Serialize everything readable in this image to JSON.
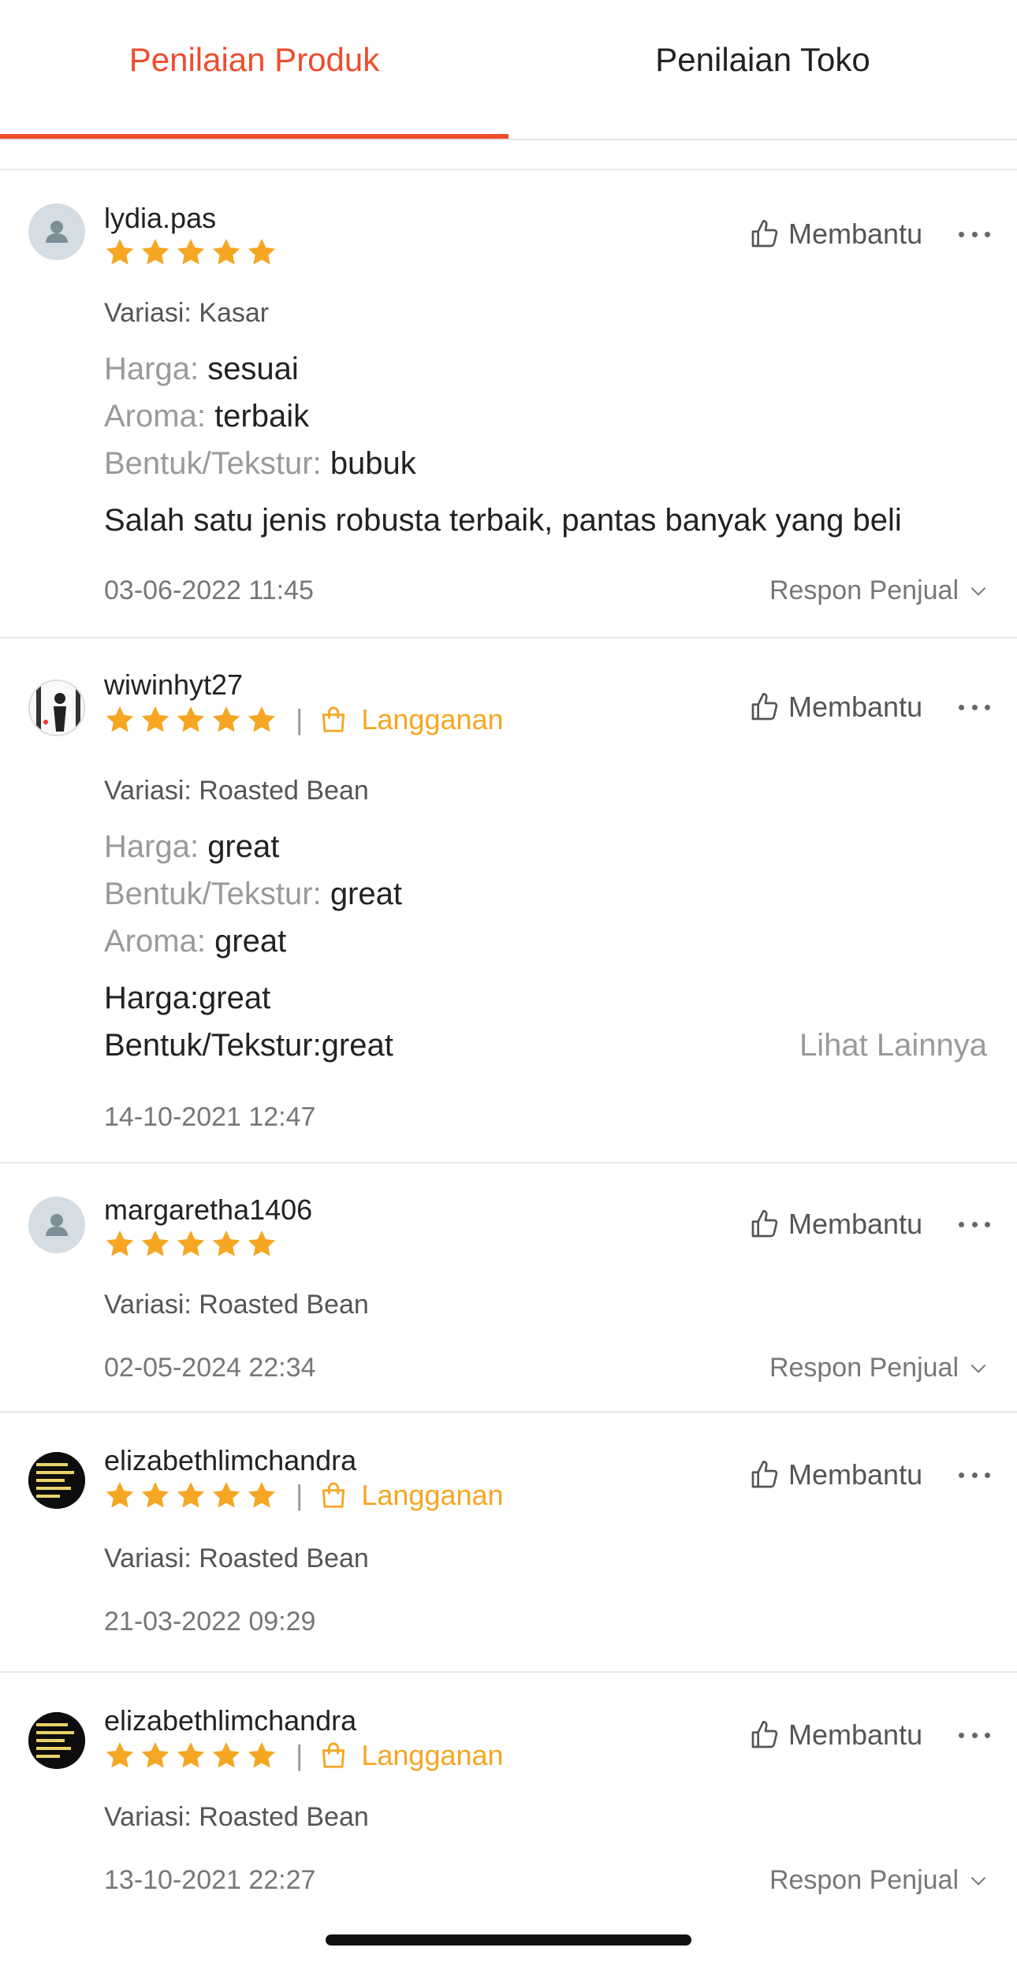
{
  "tabs": {
    "product": "Penilaian Produk",
    "shop": "Penilaian Toko"
  },
  "colors": {
    "accent": "#ee4d2d",
    "star": "#f5a623"
  },
  "labels": {
    "helpful": "Membantu",
    "seller_response": "Respon Penjual",
    "see_more": "Lihat Lainnya",
    "subscription": "Langganan",
    "separator": "|"
  },
  "reviews": [
    {
      "username": "lydia.pas",
      "rating": 5,
      "variation": "Variasi: Kasar",
      "attributes": [
        {
          "key": "Harga:",
          "value": "sesuai"
        },
        {
          "key": "Aroma:",
          "value": "terbaik"
        },
        {
          "key": "Bentuk/Tekstur:",
          "value": "bubuk"
        }
      ],
      "comment": "Salah satu jenis robusta terbaik, pantas banyak yang beli",
      "date": "03-06-2022 11:45"
    },
    {
      "username": "wiwinhyt27",
      "rating": 5,
      "variation": "Variasi: Roasted Bean",
      "attributes": [
        {
          "key": "Harga:",
          "value": "great"
        },
        {
          "key": "Bentuk/Tekstur:",
          "value": "great"
        },
        {
          "key": "Aroma:",
          "value": "great"
        }
      ],
      "comment_lines": [
        "Harga:great",
        "Bentuk/Tekstur:great"
      ],
      "date": "14-10-2021 12:47"
    },
    {
      "username": "margaretha1406",
      "rating": 5,
      "variation": "Variasi: Roasted Bean",
      "date": "02-05-2024 22:34"
    },
    {
      "username": "elizabethlimchandra",
      "rating": 5,
      "variation": "Variasi: Roasted Bean",
      "date": "21-03-2022 09:29"
    },
    {
      "username": "elizabethlimchandra",
      "rating": 5,
      "variation": "Variasi: Roasted Bean",
      "date": "13-10-2021 22:27"
    }
  ]
}
